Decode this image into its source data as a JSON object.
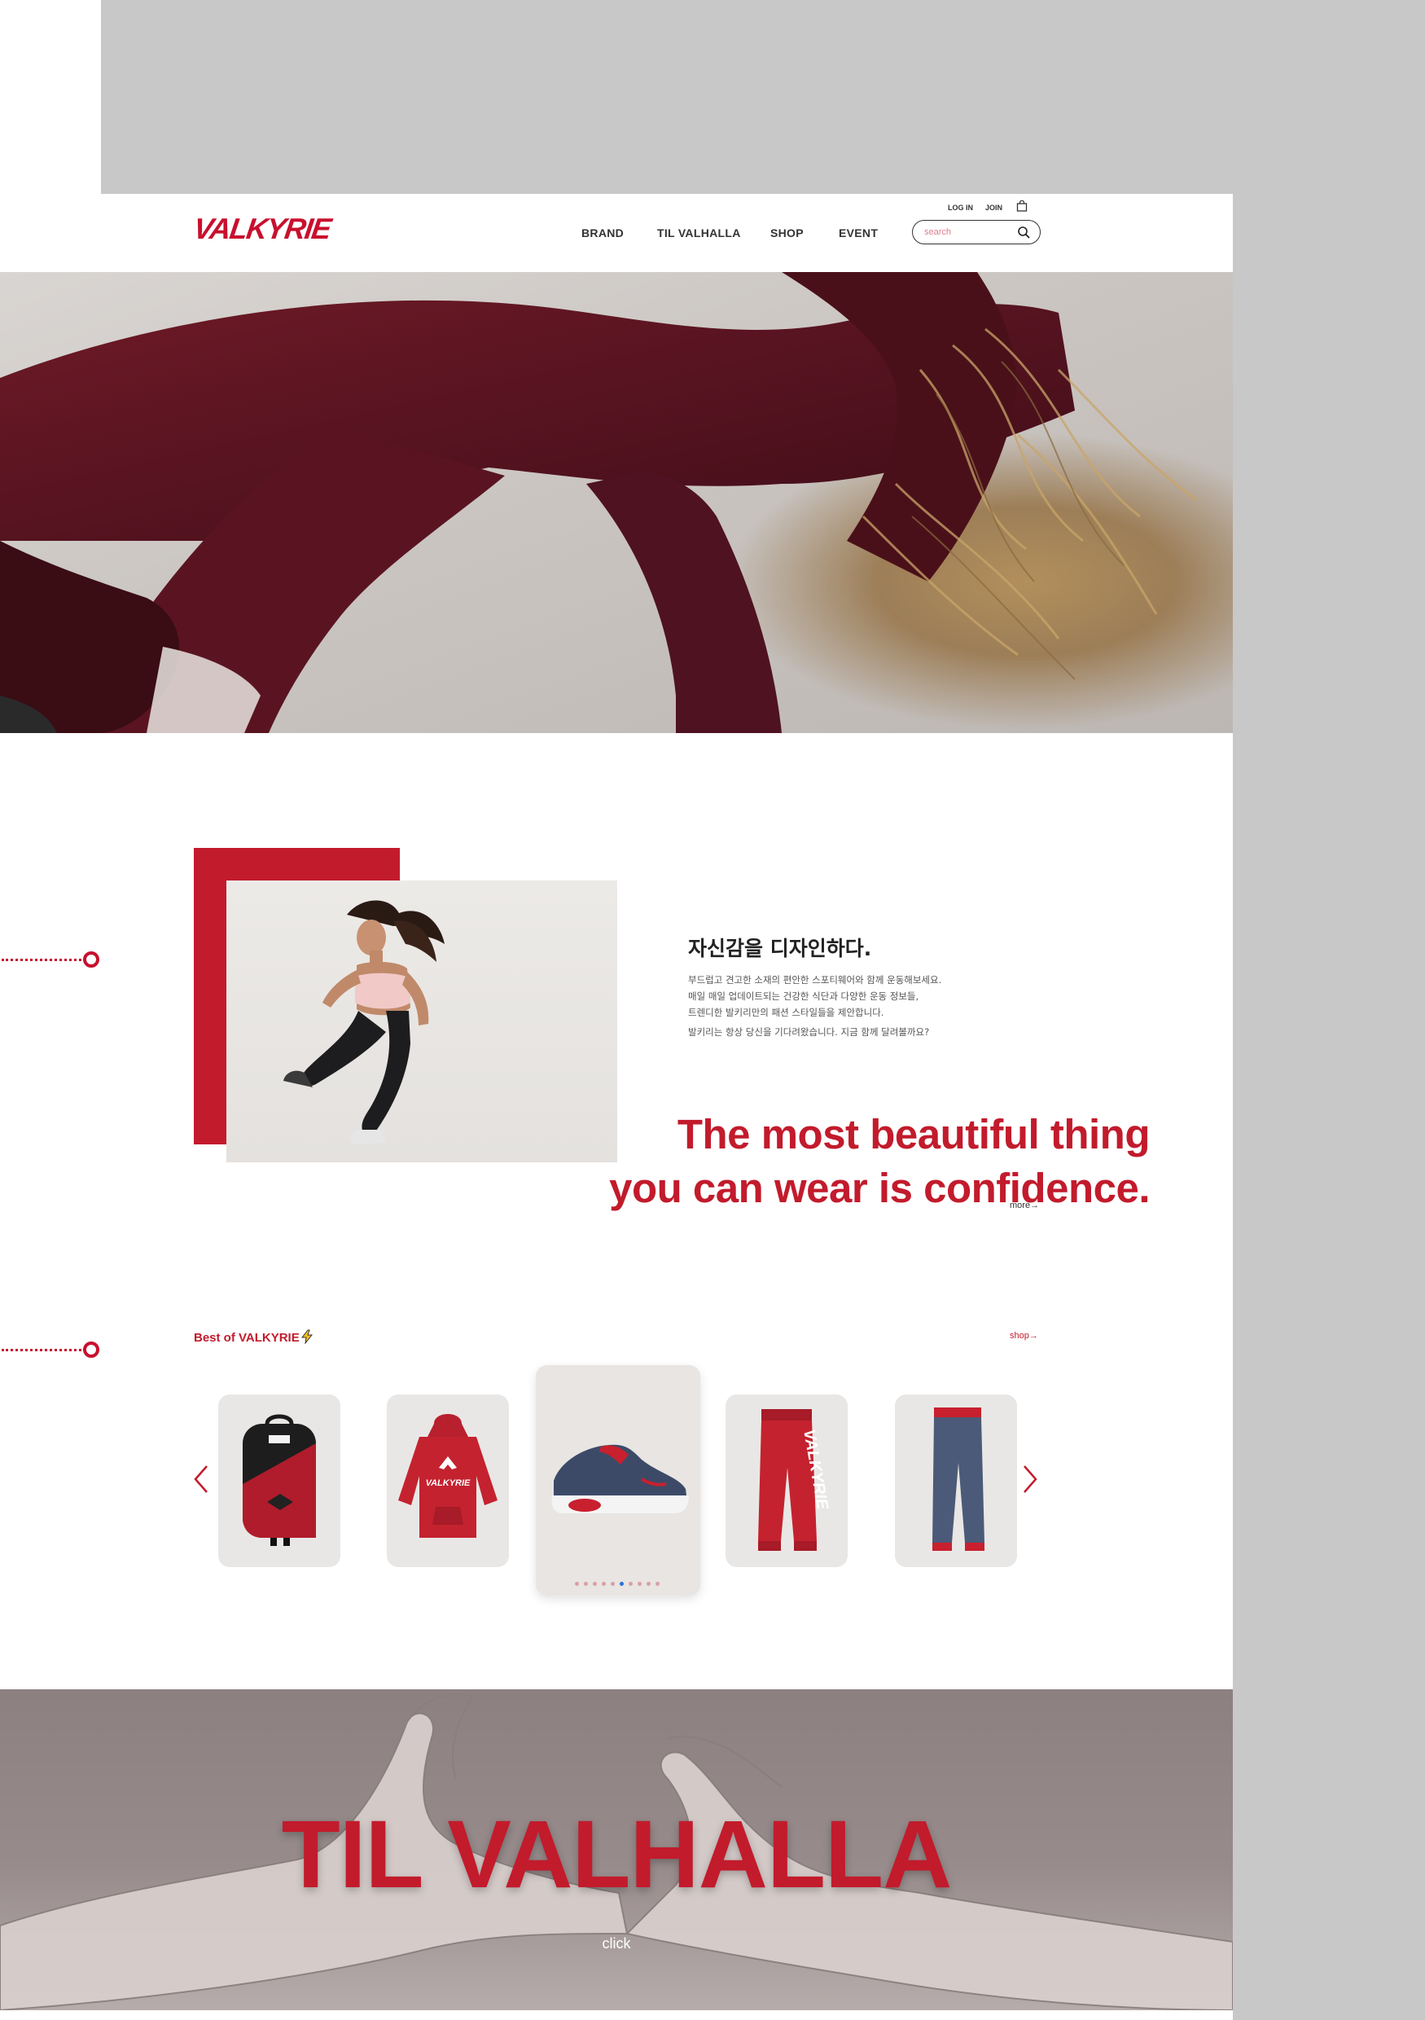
{
  "brand": {
    "logo_text": "VALKYRIE",
    "accent_color": "#c21b2c"
  },
  "header": {
    "nav": [
      "BRAND",
      "TIL VALHALLA",
      "SHOP",
      "EVENT"
    ],
    "login_label": "LOG IN",
    "join_label": "JOIN",
    "cart_icon": "shopping-bag-icon",
    "search": {
      "placeholder": "search",
      "value": "",
      "icon": "search-icon"
    }
  },
  "about": {
    "title": "자신감을 디자인하다.",
    "lines": [
      "부드럽고 견고한 소재의 편안한 스포티웨어와 함께 운동해보세요.",
      "매일 매일 업데이트되는 건강한 식단과 다양한 운동 정보들,",
      "트렌디한 발키리만의 패션 스타일들을 제안합니다.",
      "발키리는 항상 당신을 기다려왔습니다. 지금 함께 달려볼까요?"
    ],
    "quote_line1": "The most beautiful thing",
    "quote_line2": "you can wear is confidence.",
    "more_label": "more→"
  },
  "best": {
    "title": "Best of VALKYRIE",
    "title_icon": "lightning-icon",
    "shop_label": "shop→",
    "products": [
      "backpack",
      "hoodie",
      "sneaker",
      "red jogger pants",
      "navy jogger pants"
    ],
    "active_index": 2,
    "pager_count": 11,
    "pager_active": 6,
    "prev_icon": "chevron-left-icon",
    "next_icon": "chevron-right-icon",
    "hoodie_print": "VALKYRIE",
    "pants_print": "VALKYRIE"
  },
  "valhalla": {
    "title": "TIL VALHALLA",
    "click_label": "click"
  }
}
